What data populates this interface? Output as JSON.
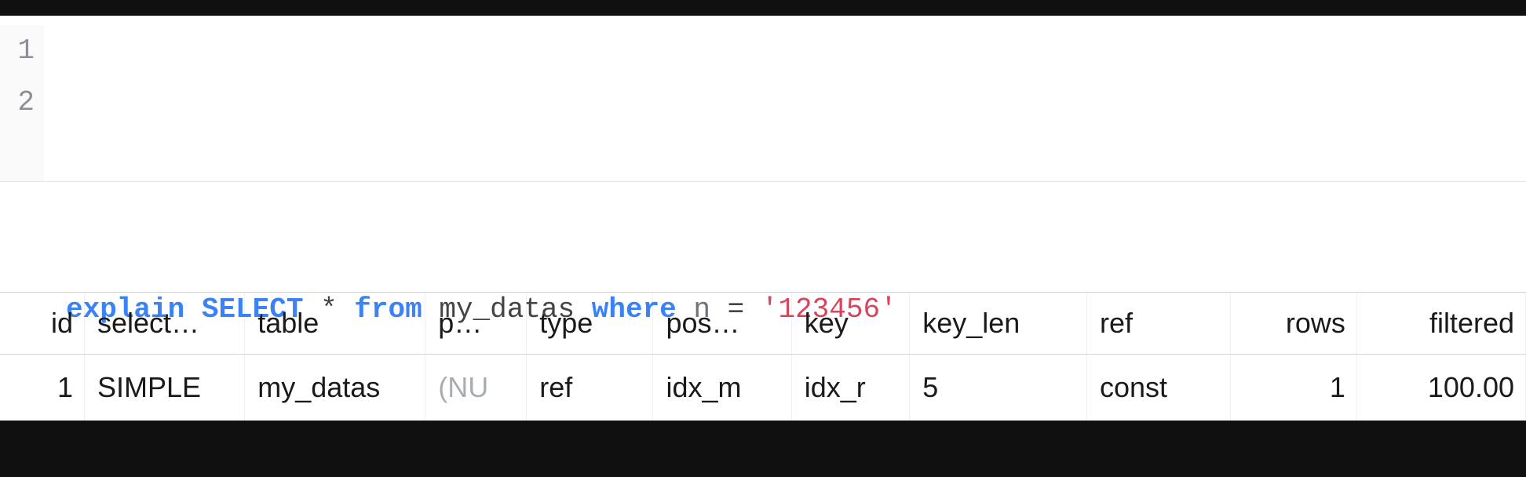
{
  "editor": {
    "gutter": [
      "1",
      "2"
    ],
    "code_line2": {
      "kw_explain": "explain",
      "kw_select": "SELECT",
      "star": "*",
      "kw_from": "from",
      "table_name": "my_datas",
      "kw_where": "where",
      "column": "n",
      "eq": "=",
      "string": "'123456'"
    }
  },
  "table": {
    "columns": [
      {
        "key": "id",
        "label": "id",
        "cls": "c-id num"
      },
      {
        "key": "select",
        "label": "select…",
        "cls": "c-select"
      },
      {
        "key": "table",
        "label": "table",
        "cls": "c-table"
      },
      {
        "key": "part",
        "label": "p…",
        "cls": "c-part"
      },
      {
        "key": "type",
        "label": "type",
        "cls": "c-type"
      },
      {
        "key": "poss",
        "label": "pos…",
        "cls": "c-poss"
      },
      {
        "key": "key",
        "label": "key",
        "cls": "c-key"
      },
      {
        "key": "keylen",
        "label": "key_len",
        "cls": "c-keylen"
      },
      {
        "key": "ref",
        "label": "ref",
        "cls": "c-ref"
      },
      {
        "key": "rows",
        "label": "rows",
        "cls": "c-rows num"
      },
      {
        "key": "filtered",
        "label": "filtered",
        "cls": "c-filtered num"
      }
    ],
    "rows": [
      {
        "id": "1",
        "select": "SIMPLE",
        "table": "my_datas",
        "part": "(NU",
        "part_null": true,
        "type": "ref",
        "poss": "idx_m",
        "key": "idx_r",
        "keylen": "5",
        "ref": "const",
        "rows": "1",
        "filtered": "100.00"
      }
    ]
  }
}
